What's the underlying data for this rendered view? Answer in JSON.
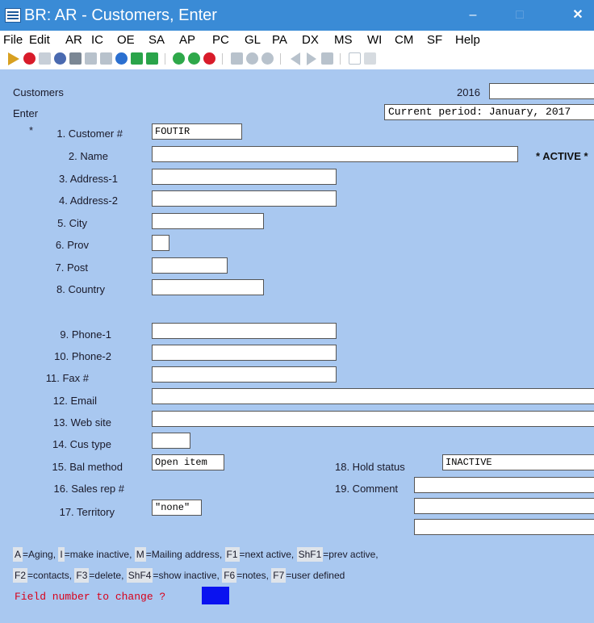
{
  "window": {
    "title": "BR: AR - Customers, Enter",
    "minimize": "–",
    "maximize": "□",
    "close": "✕"
  },
  "menu": [
    "File",
    "Edit",
    "AR",
    "IC",
    "OE",
    "SA",
    "AP",
    "PC",
    "GL",
    "PA",
    "DX",
    "MS",
    "WI",
    "CM",
    "SF",
    "Help"
  ],
  "toolbar_icons": [
    "run-icon",
    "stop-icon",
    "tools-icon",
    "settings-icon",
    "keyboard-icon",
    "check-icon",
    "cancel-icon",
    "undo-icon",
    "arrow-up-icon",
    "arrow-down-icon",
    "refresh-icon",
    "go-icon",
    "close-circle-icon",
    "binoculars-icon",
    "zoom-icon",
    "find-icon",
    "prev-icon",
    "next-icon",
    "print-icon",
    "page-icon",
    "copy-icon"
  ],
  "header": {
    "screen": "Customers",
    "mode": "Enter",
    "year": "2016",
    "year_box": "",
    "period": "Current period: January, 2017"
  },
  "fields": [
    {
      "label": "1. Customer #",
      "value": "FOUTIR"
    },
    {
      "label": "2. Name",
      "value": ""
    },
    {
      "label": "3. Address-1",
      "value": ""
    },
    {
      "label": "4. Address-2",
      "value": ""
    },
    {
      "label": "5. City",
      "value": ""
    },
    {
      "label": "6. Prov",
      "value": ""
    },
    {
      "label": "7. Post",
      "value": ""
    },
    {
      "label": "8. Country",
      "value": ""
    },
    {
      "label": "9. Phone-1",
      "value": ""
    },
    {
      "label": "10. Phone-2",
      "value": ""
    },
    {
      "label": "11. Fax #",
      "value": ""
    },
    {
      "label": "12. Email",
      "value": ""
    },
    {
      "label": "13. Web site",
      "value": ""
    },
    {
      "label": "14. Cus type",
      "value": ""
    },
    {
      "label": "15. Bal method",
      "value": "Open item"
    },
    {
      "label": "16. Sales rep #",
      "value": ""
    },
    {
      "label": "17. Territory",
      "value": "\"none\""
    },
    {
      "label": "18. Hold status",
      "value": "INACTIVE"
    },
    {
      "label": "19. Comment",
      "value": "",
      "value2": "",
      "value3": ""
    }
  ],
  "required_marker": "*",
  "status_active": "* ACTIVE *",
  "keys": {
    "line1": [
      [
        "A",
        "=Aging, "
      ],
      [
        "I",
        "=make inactive, "
      ],
      [
        "M",
        "=Mailing address, "
      ],
      [
        "F1",
        "=next active, "
      ],
      [
        "ShF1",
        "=prev active,"
      ]
    ],
    "line2": [
      [
        "F2",
        "=contacts, "
      ],
      [
        "F3",
        "=delete, "
      ],
      [
        "ShF4",
        "=show inactive, "
      ],
      [
        "F6",
        "=notes, "
      ],
      [
        "F7",
        "=user defined"
      ]
    ]
  },
  "prompt": "Field number to change ?",
  "colors": {
    "titlebar": "#3a8bd6",
    "form_bg": "#a9c8f0",
    "prompt": "#d8001a",
    "cursor": "#0a12f0"
  }
}
